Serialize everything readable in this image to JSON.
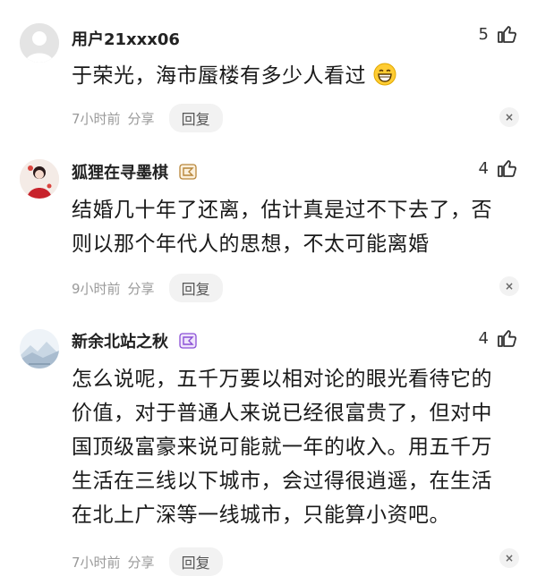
{
  "comments": [
    {
      "username": "用户21xxx06",
      "likes": "5",
      "text": "于荣光，海市蜃楼有多少人看过",
      "time": "7小时前",
      "share": "分享",
      "reply": "回复",
      "close": "×",
      "has_emoji": true
    },
    {
      "username": "狐狸在寻墨棋",
      "likes": "4",
      "text_lines": [
        "结婚几十年了还离，估计真是过不下去了，否",
        "则以那个年代人的思想，不太可能离婚"
      ],
      "time": "9小时前",
      "share": "分享",
      "reply": "回复",
      "close": "×",
      "badge_color": "#b8863a"
    },
    {
      "username": "新余北站之秋",
      "likes": "4",
      "text_lines": [
        "怎么说呢，五千万要以相对论的眼光看待它的",
        "价值，对于普通人来说已经很富贵了，但对中",
        "国顶级富豪来说可能就一年的收入。用五千万",
        "生活在三线以下城市，会过得很逍遥，在生活",
        "在北上广深等一线城市，只能算小资吧。"
      ],
      "time": "7小时前",
      "share": "分享",
      "reply": "回复",
      "close": "×",
      "badge_color": "#8a4fd6"
    }
  ]
}
